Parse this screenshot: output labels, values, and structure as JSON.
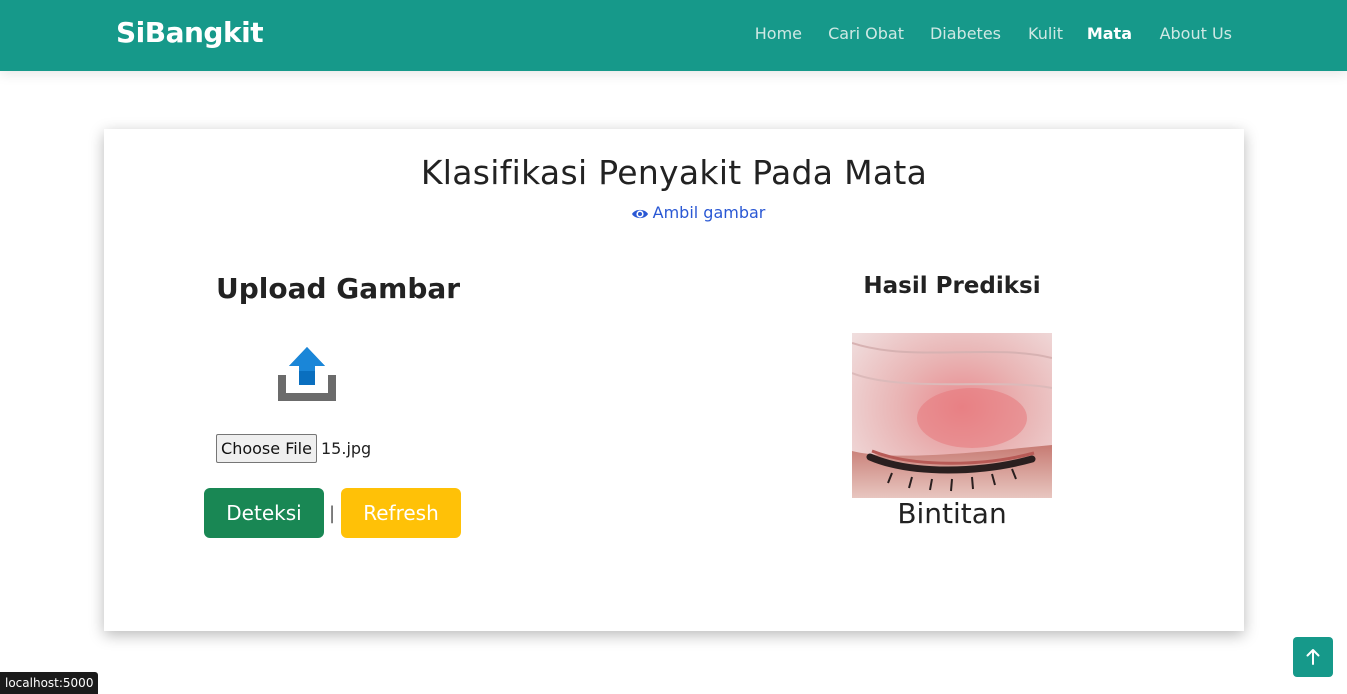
{
  "header": {
    "brand": "SiBangkit",
    "nav": [
      {
        "label": "Home",
        "active": false
      },
      {
        "label": "Cari Obat",
        "active": false
      },
      {
        "label": "Diabetes",
        "active": false
      },
      {
        "label": "Kulit",
        "active": false
      },
      {
        "label": "Mata",
        "active": true
      },
      {
        "label": "About Us",
        "active": false
      }
    ]
  },
  "main": {
    "title": "Klasifikasi Penyakit Pada Mata",
    "camera_link": "Ambil gambar",
    "upload": {
      "title": "Upload Gambar",
      "choose_file_label": "Choose File",
      "file_name": "15.jpg"
    },
    "buttons": {
      "detect": "Deteksi",
      "separator": "|",
      "refresh": "Refresh"
    },
    "result": {
      "title": "Hasil Prediksi",
      "label": "Bintitan"
    }
  },
  "status_bar": {
    "url": "localhost:5000"
  },
  "colors": {
    "primary": "#16998a",
    "detect_button": "#198754",
    "refresh_button": "#ffc107",
    "link": "#2a58d4"
  },
  "icons": {
    "camera_link": "eye-icon",
    "upload": "upload-icon",
    "back_to_top": "arrow-up-icon"
  }
}
